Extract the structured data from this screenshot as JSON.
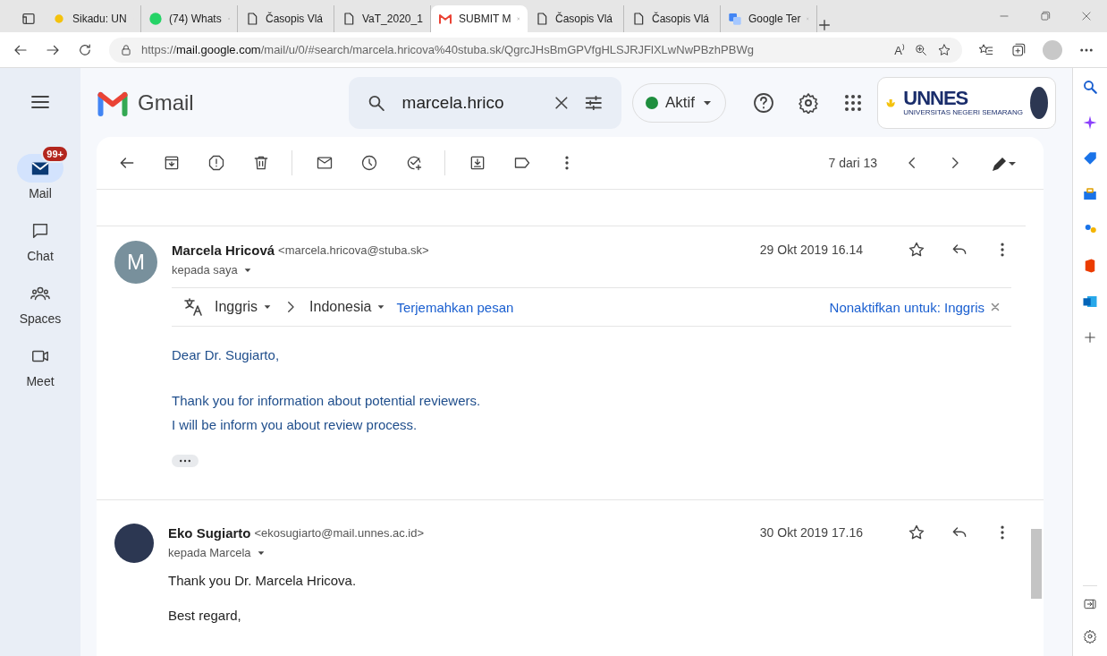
{
  "browser": {
    "tabs": [
      {
        "label": "Sikadu: UN",
        "kind": "sun",
        "selected": false
      },
      {
        "label": "(74) Whats",
        "kind": "chat",
        "selected": false
      },
      {
        "label": "Časopis Vlá",
        "kind": "doc",
        "selected": false
      },
      {
        "label": "VaT_2020_1",
        "kind": "doc",
        "selected": false
      },
      {
        "label": "SUBMIT M",
        "kind": "mail",
        "selected": true
      },
      {
        "label": "Časopis Vlá",
        "kind": "doc",
        "selected": false
      },
      {
        "label": "Časopis Vlá",
        "kind": "doc",
        "selected": false
      },
      {
        "label": "Google Ter",
        "kind": "translate",
        "selected": false
      }
    ],
    "url": "https://**mail.google.com**/mail/u/0/#search/marcela.hricova%40stuba.sk/QgrcJHsBmGPVfgHLSJRJFlXLwNwPBzhPBWg",
    "reader_label": "A⁾"
  },
  "gmail": {
    "product": "Gmail",
    "search": {
      "value": "marcela.hrico"
    },
    "status": "Aktif",
    "logo": {
      "name": "UNNES",
      "subtitle": "UNIVERSITAS NEGERI SEMARANG"
    },
    "rail": [
      {
        "label": "Mail",
        "kind": "mail",
        "selected": true,
        "badge": "99+"
      },
      {
        "label": "Chat",
        "kind": "chat",
        "selected": false
      },
      {
        "label": "Spaces",
        "kind": "spaces",
        "selected": false
      },
      {
        "label": "Meet",
        "kind": "meet",
        "selected": false
      }
    ],
    "pager": "7 dari 13",
    "messages": [
      {
        "sender": "Marcela Hricová",
        "email": "<marcela.hricova@stuba.sk>",
        "date": "29 Okt 2019 16.14",
        "to": "kepada saya",
        "avatar": {
          "kind": "letter",
          "letter": "M"
        },
        "translate": {
          "from": "Inggris",
          "to": "Indonesia",
          "action": "Terjemahkan pesan",
          "disable": "Nonaktifkan untuk: Inggris"
        },
        "tinted": true,
        "paragraphs": [
          [
            "Dear Dr. Sugiarto,"
          ],
          [
            "Thank you for information about potential reviewers.",
            "I will be inform you about review process."
          ]
        ],
        "trimmed": true
      },
      {
        "sender": "Eko Sugiarto",
        "email": "<ekosugiarto@mail.unnes.ac.id>",
        "date": "30 Okt 2019 17.16",
        "to": "kepada Marcela",
        "avatar": {
          "kind": "photo"
        },
        "tinted": false,
        "paragraphs": [
          [
            "Thank you Dr. Marcela Hricova."
          ],
          [
            "Best regard,"
          ]
        ],
        "trimmed": false
      }
    ]
  }
}
